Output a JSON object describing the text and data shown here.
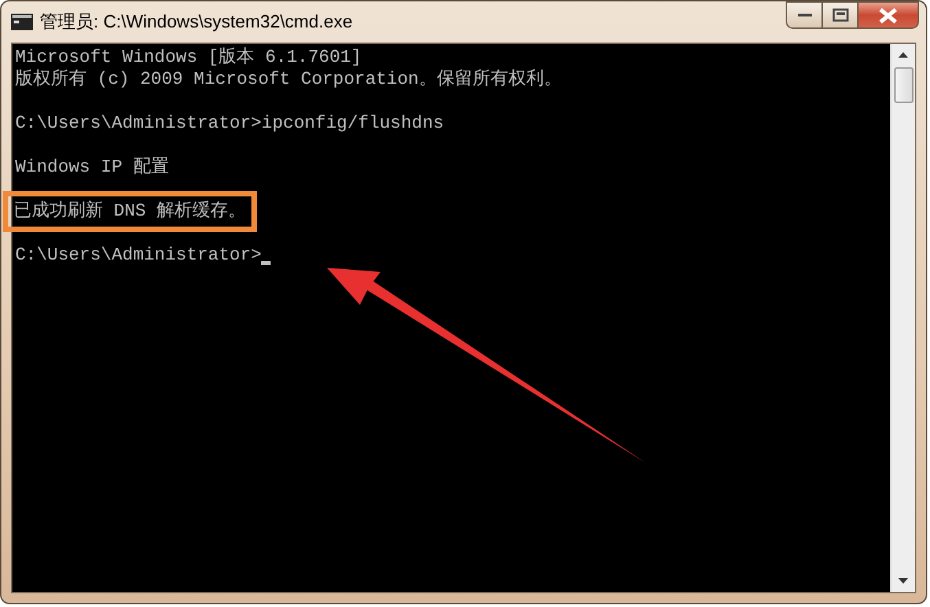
{
  "window": {
    "title": "管理员: C:\\Windows\\system32\\cmd.exe"
  },
  "console": {
    "lines": [
      {
        "kind": "text",
        "text": "Microsoft Windows [版本 6.1.7601]",
        "highlighted": false,
        "cursor": false
      },
      {
        "kind": "text",
        "text": "版权所有 (c) 2009 Microsoft Corporation。保留所有权利。",
        "highlighted": false,
        "cursor": false
      },
      {
        "kind": "blank"
      },
      {
        "kind": "text",
        "text": "C:\\Users\\Administrator>ipconfig/flushdns",
        "highlighted": false,
        "cursor": false
      },
      {
        "kind": "blank"
      },
      {
        "kind": "text",
        "text": "Windows IP 配置",
        "highlighted": false,
        "cursor": false
      },
      {
        "kind": "blank"
      },
      {
        "kind": "text",
        "text": "已成功刷新 DNS 解析缓存。",
        "highlighted": true,
        "cursor": false
      },
      {
        "kind": "blank"
      },
      {
        "kind": "text",
        "text": "C:\\Users\\Administrator>",
        "highlighted": false,
        "cursor": true
      }
    ]
  },
  "annotation": {
    "kind": "arrow"
  }
}
